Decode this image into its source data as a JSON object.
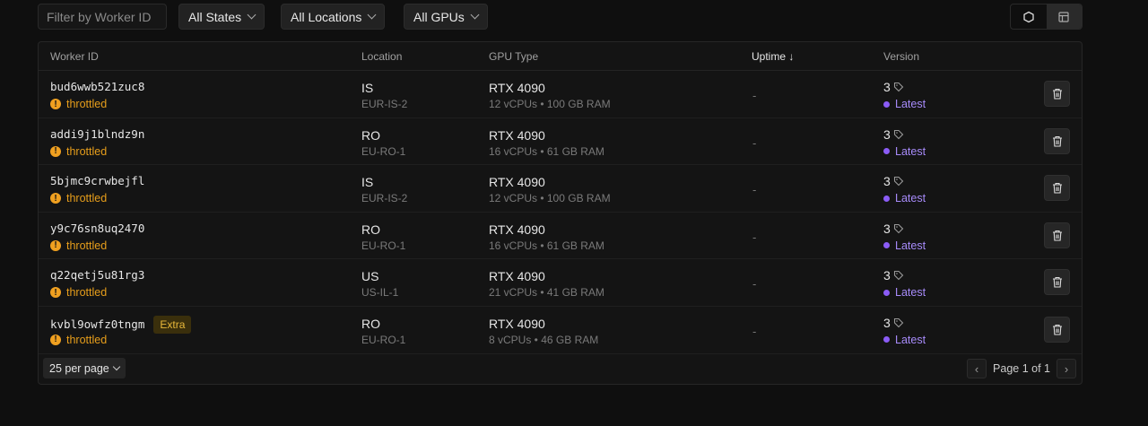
{
  "filters": {
    "search_placeholder": "Filter by Worker ID",
    "states": "All States",
    "locations": "All Locations",
    "gpus": "All GPUs"
  },
  "columns": {
    "worker_id": "Worker ID",
    "location": "Location",
    "gpu_type": "GPU Type",
    "uptime": "Uptime",
    "version": "Version"
  },
  "rows": [
    {
      "id": "bud6wwb521zuc8",
      "status": "throttled",
      "loc": "IS",
      "region": "EUR-IS-2",
      "gpu": "RTX 4090",
      "specs": "12 vCPUs • 100 GB RAM",
      "uptime": "-",
      "version": "3",
      "tag": "Latest"
    },
    {
      "id": "addi9j1blndz9n",
      "status": "throttled",
      "loc": "RO",
      "region": "EU-RO-1",
      "gpu": "RTX 4090",
      "specs": "16 vCPUs • 61 GB RAM",
      "uptime": "-",
      "version": "3",
      "tag": "Latest"
    },
    {
      "id": "5bjmc9crwbejfl",
      "status": "throttled",
      "loc": "IS",
      "region": "EUR-IS-2",
      "gpu": "RTX 4090",
      "specs": "12 vCPUs • 100 GB RAM",
      "uptime": "-",
      "version": "3",
      "tag": "Latest"
    },
    {
      "id": "y9c76sn8uq2470",
      "status": "throttled",
      "loc": "RO",
      "region": "EU-RO-1",
      "gpu": "RTX 4090",
      "specs": "16 vCPUs • 61 GB RAM",
      "uptime": "-",
      "version": "3",
      "tag": "Latest"
    },
    {
      "id": "q22qetj5u81rg3",
      "status": "throttled",
      "loc": "US",
      "region": "US-IL-1",
      "gpu": "RTX 4090",
      "specs": "21 vCPUs • 41 GB RAM",
      "uptime": "-",
      "version": "3",
      "tag": "Latest"
    },
    {
      "id": "kvbl9owfz0tngm",
      "badge": "Extra",
      "status": "throttled",
      "loc": "RO",
      "region": "EU-RO-1",
      "gpu": "RTX 4090",
      "specs": "8 vCPUs • 46 GB RAM",
      "uptime": "-",
      "version": "3",
      "tag": "Latest"
    }
  ],
  "footer": {
    "per_page": "25 per page",
    "page": "Page 1 of 1"
  }
}
